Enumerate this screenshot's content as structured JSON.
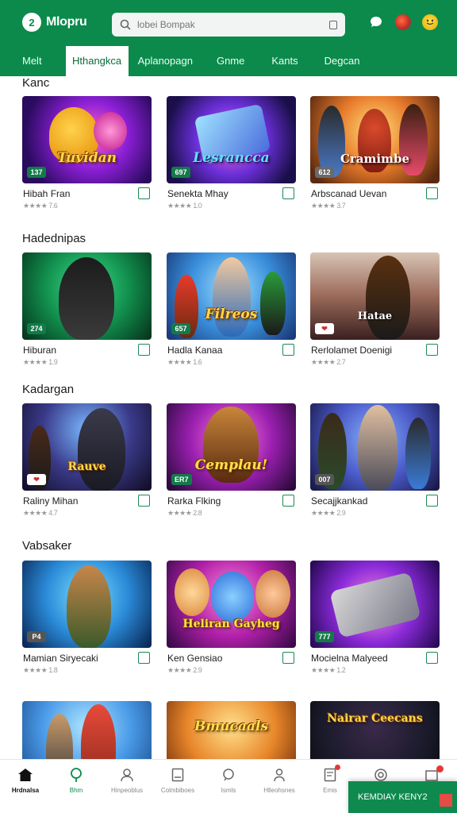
{
  "app": {
    "logo_badge": "2",
    "name": "Mlopru"
  },
  "search": {
    "placeholder": "lobei Bompak"
  },
  "header_icons": [
    "chat-icon",
    "flag-icon",
    "emoji-icon"
  ],
  "tabs": [
    "Melt",
    "Hthangkca",
    "Aplanopagn",
    "Gnme",
    "Kants",
    "Degcan"
  ],
  "sections": [
    {
      "title": "Kanc",
      "cards": [
        {
          "name": "Hibah Fran",
          "badge": "137",
          "rating": "★★★★ 7.6",
          "art": "Tuvidan"
        },
        {
          "name": "Senekta Mhay",
          "badge": "697",
          "rating": "★★★★ 1.0",
          "art": "Lesrancca"
        },
        {
          "name": "Arbscanad Uevan",
          "badge": "612",
          "rating": "★★★★ 3.7",
          "art": "Cramimbe"
        }
      ]
    },
    {
      "title": "Hadednipas",
      "cards": [
        {
          "name": "Hiburan",
          "badge": "274",
          "rating": "★★★★ 1.9",
          "art": ""
        },
        {
          "name": "Hadla Kanaa",
          "badge": "657",
          "rating": "★★★★ 1.6",
          "art": "Filreos"
        },
        {
          "name": "Rerlolamet Doenigi",
          "badge": "❤",
          "rating": "★★★★ 2.7",
          "art": "Hatae"
        }
      ]
    },
    {
      "title": "Kadargan",
      "cards": [
        {
          "name": "Raliny Mihan",
          "badge": "❤",
          "rating": "★★★★ 4.7",
          "art": "Rauve"
        },
        {
          "name": "Rarka Flking",
          "badge": "ER7",
          "rating": "★★★★ 2.8",
          "art": "Cemplau!"
        },
        {
          "name": "Secajjkankad",
          "badge": "007",
          "rating": "★★★★ 2.9",
          "art": ""
        }
      ]
    },
    {
      "title": "Vabsaker",
      "cards": [
        {
          "name": "Mamian Siryecaki",
          "badge": "P4",
          "rating": "★★★★ 1.8",
          "art": ""
        },
        {
          "name": "Ken Gensiao",
          "badge": "",
          "rating": "★★★★ 2.9",
          "art": "Heliran Gayheg"
        },
        {
          "name": "Mocielna Malyeed",
          "badge": "777",
          "rating": "★★★★ 1.2",
          "art": ""
        }
      ]
    },
    {
      "title": "",
      "cards": [
        {
          "name": "",
          "badge": "",
          "rating": "",
          "art": ""
        },
        {
          "name": "",
          "badge": "",
          "rating": "",
          "art": "Bmucaals"
        },
        {
          "name": "",
          "badge": "",
          "rating": "",
          "art": "Nairar Ceecans"
        }
      ]
    }
  ],
  "bottom_nav": [
    {
      "label": "Hrdnalsa",
      "icon": "home-icon",
      "active": true
    },
    {
      "label": "Bhm",
      "icon": "pin-icon",
      "active": false
    },
    {
      "label": "Hinpeoblus",
      "icon": "person-icon",
      "active": false
    },
    {
      "label": "Colmbiboes",
      "icon": "doc-icon",
      "active": false
    },
    {
      "label": "Ismls",
      "icon": "chat-icon",
      "active": false
    },
    {
      "label": "Hlleohsnes",
      "icon": "user-icon",
      "active": false
    },
    {
      "label": "Emis",
      "icon": "notes-icon",
      "active": false
    },
    {
      "label": "",
      "icon": "at-icon",
      "active": false
    },
    {
      "label": "",
      "icon": "cart-icon",
      "active": false
    }
  ],
  "promo": {
    "label": "KEMDIAY KENY2"
  },
  "colors": {
    "brand": "#0b8a4c",
    "check": "#1b8a55",
    "badge": "#137a49"
  }
}
